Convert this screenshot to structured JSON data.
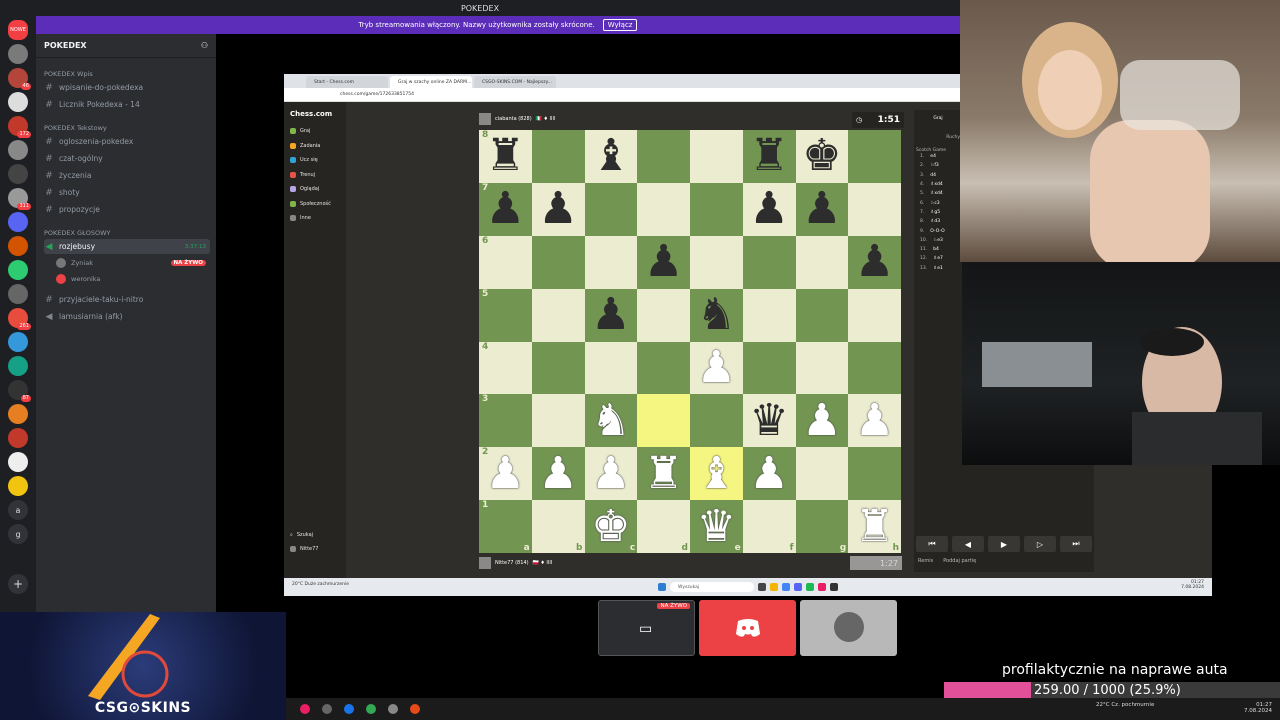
{
  "window": {
    "title": "POKEDEX"
  },
  "banner": {
    "text": "Tryb streamowania włączony. Nazwy użytkownika zostały skrócone.",
    "button": "Wyłącz"
  },
  "server_rail": {
    "new_label": "NOWE",
    "letters": [
      "a",
      "g"
    ],
    "badges": [
      "46",
      "172",
      "311",
      "261",
      "87"
    ]
  },
  "server": {
    "name": "POKEDEX",
    "categories": [
      {
        "name": "POKEDEX Wpis",
        "channels": [
          "wpisanie-do-pokedexa",
          "Licznik Pokedexa - 14"
        ]
      },
      {
        "name": "POKEDEX Tekstowy",
        "channels": [
          "ogloszenia-pokedex",
          "czat-ogólny",
          "życzenia",
          "shoty",
          "propozycje"
        ]
      },
      {
        "name": "POKEDEX GŁOSOWY",
        "channels": []
      }
    ],
    "voice_channel": {
      "name": "rozjebusy",
      "timer": "3:37:13",
      "users": [
        "Zyniak",
        "weronika"
      ],
      "live_label": "NA ŻYWO"
    },
    "extra_channels": [
      "przyjaciele-taku-i-nitro",
      "lamusiarnia (afk)"
    ]
  },
  "browser": {
    "tabs": [
      "Start - Chess.com",
      "Graj w szachy online ZA DARM...",
      "CSGO-SKINS.COM - Najlepszy..."
    ],
    "url": "chess.com/game/172633851754"
  },
  "chess_site": {
    "logo": "Chess.com",
    "nav": [
      "Graj",
      "Zadania",
      "Ucz się",
      "Trenuj",
      "Oglądaj",
      "Społeczność",
      "Inne"
    ],
    "nav_colors": [
      "#81b64c",
      "#f6a625",
      "#2fa3d8",
      "#e8524a",
      "#b7a6e6",
      "#81b64c",
      "#888888"
    ],
    "bottom_items": [
      "Szukaj",
      "Nitte77"
    ],
    "top_player": {
      "name": "ciabanta (828)",
      "rating_flags": "🇮🇹 ♦ IIII"
    },
    "bottom_player": {
      "name": "Nitte77 (814)",
      "rating_flags": "🇵🇱 ♦ IIII"
    },
    "top_clock": "1:51",
    "bottom_clock": "1:27",
    "files": [
      "a",
      "b",
      "c",
      "d",
      "e",
      "f",
      "g",
      "h"
    ],
    "ranks": [
      "8",
      "7",
      "6",
      "5",
      "4",
      "3",
      "2",
      "1"
    ],
    "panel": {
      "play": "Graj",
      "moves_tab": "Ruchy",
      "opening": "Scotch Game"
    },
    "move_numbers": [
      "1.",
      "2.",
      "3.",
      "4.",
      "5.",
      "6.",
      "7.",
      "8.",
      "9.",
      "10.",
      "11.",
      "12.",
      "13."
    ],
    "moves_white": [
      "e4",
      "♘f3",
      "d4",
      "♗xd4",
      "♗xd4",
      "♘c3",
      "♗g5",
      "♗d3",
      "O-O-O",
      "♘e3",
      "b4",
      "♗e7",
      "♗e1"
    ],
    "moves_black": [
      "",
      "",
      "",
      "",
      "",
      "",
      "",
      "",
      "",
      "",
      "",
      "",
      ""
    ],
    "nav_buttons": [
      "⏮",
      "◀",
      "▶",
      "▷",
      "⏭"
    ],
    "panel_footer": [
      "Remis",
      "Poddaj partię"
    ],
    "board": [
      [
        "r",
        "",
        "b",
        "",
        "",
        "r",
        "k",
        ""
      ],
      [
        "p",
        "p",
        "",
        "",
        "",
        "p",
        "p",
        ""
      ],
      [
        "",
        "",
        "",
        "p",
        "",
        "",
        "",
        "p"
      ],
      [
        "",
        "",
        "p",
        "",
        "n",
        "",
        "",
        ""
      ],
      [
        "",
        "",
        "",
        "",
        "P",
        "",
        "",
        ""
      ],
      [
        "",
        "",
        "N",
        "",
        "",
        "q",
        "P",
        "P"
      ],
      [
        "P",
        "P",
        "P",
        "R",
        "B",
        "P",
        "",
        ""
      ],
      [
        "",
        "",
        "K",
        "",
        "Q",
        "",
        "",
        "R"
      ]
    ],
    "highlight": [
      [
        5,
        3
      ],
      [
        6,
        4
      ]
    ]
  },
  "windows_taskbar": {
    "search": "Wyszukaj",
    "weather": "20°C Duże zachmurzenie",
    "time": "01:27",
    "date": "7.08.2024"
  },
  "stream_tiles": {
    "live_label": "NA ŻYWO"
  },
  "promo": {
    "text": "CSG⊙SKINS"
  },
  "goal": {
    "title": "profilaktycznie na naprawe auta",
    "progress": "259.00 / 1000 (25.9%)",
    "fraction": 0.259
  },
  "obs_taskbar": {
    "weather": "22°C Cz. pochmurnie",
    "time": "01:27",
    "date": "7.08.2024"
  }
}
